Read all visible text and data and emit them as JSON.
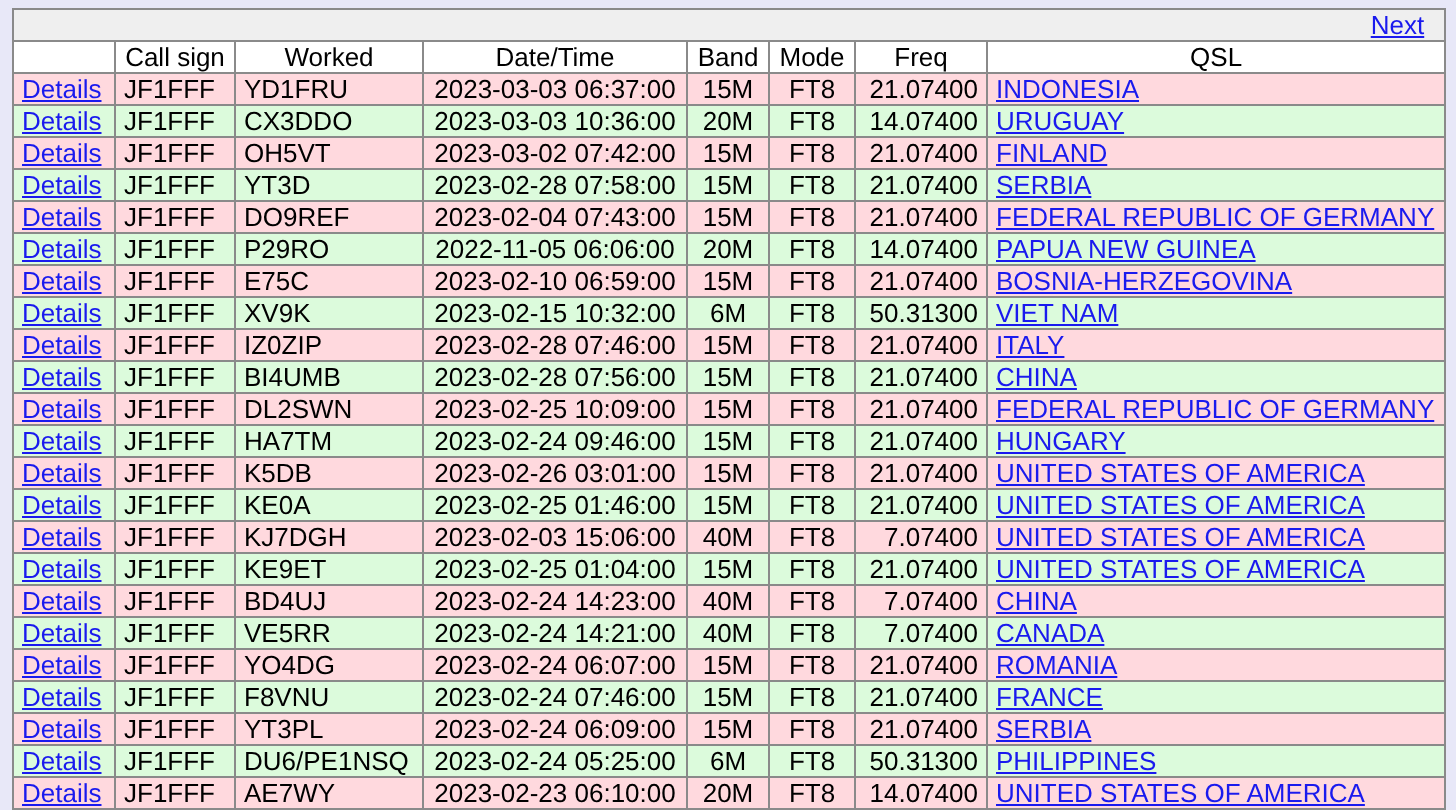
{
  "pager": {
    "next_link": "Next"
  },
  "table": {
    "columns": [
      "Call sign",
      "Worked",
      "Date/Time",
      "Band",
      "Mode",
      "Freq",
      "QSL"
    ],
    "rows": [
      {
        "details": "Details",
        "call_sign": "JF1FFF",
        "worked": "YD1FRU",
        "date_time": "2023-03-03 06:37:00",
        "band": "15M",
        "mode": "FT8",
        "freq": "21.07400",
        "qsl": "INDONESIA"
      },
      {
        "details": "Details",
        "call_sign": "JF1FFF",
        "worked": "CX3DDO",
        "date_time": "2023-03-03 10:36:00",
        "band": "20M",
        "mode": "FT8",
        "freq": "14.07400",
        "qsl": "URUGUAY"
      },
      {
        "details": "Details",
        "call_sign": "JF1FFF",
        "worked": "OH5VT",
        "date_time": "2023-03-02 07:42:00",
        "band": "15M",
        "mode": "FT8",
        "freq": "21.07400",
        "qsl": "FINLAND"
      },
      {
        "details": "Details",
        "call_sign": "JF1FFF",
        "worked": "YT3D",
        "date_time": "2023-02-28 07:58:00",
        "band": "15M",
        "mode": "FT8",
        "freq": "21.07400",
        "qsl": "SERBIA"
      },
      {
        "details": "Details",
        "call_sign": "JF1FFF",
        "worked": "DO9REF",
        "date_time": "2023-02-04 07:43:00",
        "band": "15M",
        "mode": "FT8",
        "freq": "21.07400",
        "qsl": "FEDERAL REPUBLIC OF GERMANY"
      },
      {
        "details": "Details",
        "call_sign": "JF1FFF",
        "worked": "P29RO",
        "date_time": "2022-11-05 06:06:00",
        "band": "20M",
        "mode": "FT8",
        "freq": "14.07400",
        "qsl": "PAPUA NEW GUINEA"
      },
      {
        "details": "Details",
        "call_sign": "JF1FFF",
        "worked": "E75C",
        "date_time": "2023-02-10 06:59:00",
        "band": "15M",
        "mode": "FT8",
        "freq": "21.07400",
        "qsl": "BOSNIA-HERZEGOVINA"
      },
      {
        "details": "Details",
        "call_sign": "JF1FFF",
        "worked": "XV9K",
        "date_time": "2023-02-15 10:32:00",
        "band": "6M",
        "mode": "FT8",
        "freq": "50.31300",
        "qsl": "VIET NAM"
      },
      {
        "details": "Details",
        "call_sign": "JF1FFF",
        "worked": "IZ0ZIP",
        "date_time": "2023-02-28 07:46:00",
        "band": "15M",
        "mode": "FT8",
        "freq": "21.07400",
        "qsl": "ITALY"
      },
      {
        "details": "Details",
        "call_sign": "JF1FFF",
        "worked": "BI4UMB",
        "date_time": "2023-02-28 07:56:00",
        "band": "15M",
        "mode": "FT8",
        "freq": "21.07400",
        "qsl": "CHINA"
      },
      {
        "details": "Details",
        "call_sign": "JF1FFF",
        "worked": "DL2SWN",
        "date_time": "2023-02-25 10:09:00",
        "band": "15M",
        "mode": "FT8",
        "freq": "21.07400",
        "qsl": "FEDERAL REPUBLIC OF GERMANY"
      },
      {
        "details": "Details",
        "call_sign": "JF1FFF",
        "worked": "HA7TM",
        "date_time": "2023-02-24 09:46:00",
        "band": "15M",
        "mode": "FT8",
        "freq": "21.07400",
        "qsl": "HUNGARY"
      },
      {
        "details": "Details",
        "call_sign": "JF1FFF",
        "worked": "K5DB",
        "date_time": "2023-02-26 03:01:00",
        "band": "15M",
        "mode": "FT8",
        "freq": "21.07400",
        "qsl": "UNITED STATES OF AMERICA"
      },
      {
        "details": "Details",
        "call_sign": "JF1FFF",
        "worked": "KE0A",
        "date_time": "2023-02-25 01:46:00",
        "band": "15M",
        "mode": "FT8",
        "freq": "21.07400",
        "qsl": "UNITED STATES OF AMERICA"
      },
      {
        "details": "Details",
        "call_sign": "JF1FFF",
        "worked": "KJ7DGH",
        "date_time": "2023-02-03 15:06:00",
        "band": "40M",
        "mode": "FT8",
        "freq": "7.07400",
        "qsl": "UNITED STATES OF AMERICA"
      },
      {
        "details": "Details",
        "call_sign": "JF1FFF",
        "worked": "KE9ET",
        "date_time": "2023-02-25 01:04:00",
        "band": "15M",
        "mode": "FT8",
        "freq": "21.07400",
        "qsl": "UNITED STATES OF AMERICA"
      },
      {
        "details": "Details",
        "call_sign": "JF1FFF",
        "worked": "BD4UJ",
        "date_time": "2023-02-24 14:23:00",
        "band": "40M",
        "mode": "FT8",
        "freq": "7.07400",
        "qsl": "CHINA"
      },
      {
        "details": "Details",
        "call_sign": "JF1FFF",
        "worked": "VE5RR",
        "date_time": "2023-02-24 14:21:00",
        "band": "40M",
        "mode": "FT8",
        "freq": "7.07400",
        "qsl": "CANADA"
      },
      {
        "details": "Details",
        "call_sign": "JF1FFF",
        "worked": "YO4DG",
        "date_time": "2023-02-24 06:07:00",
        "band": "15M",
        "mode": "FT8",
        "freq": "21.07400",
        "qsl": "ROMANIA"
      },
      {
        "details": "Details",
        "call_sign": "JF1FFF",
        "worked": "F8VNU",
        "date_time": "2023-02-24 07:46:00",
        "band": "15M",
        "mode": "FT8",
        "freq": "21.07400",
        "qsl": "FRANCE"
      },
      {
        "details": "Details",
        "call_sign": "JF1FFF",
        "worked": "YT3PL",
        "date_time": "2023-02-24 06:09:00",
        "band": "15M",
        "mode": "FT8",
        "freq": "21.07400",
        "qsl": "SERBIA"
      },
      {
        "details": "Details",
        "call_sign": "JF1FFF",
        "worked": "DU6/PE1NSQ",
        "date_time": "2023-02-24 05:25:00",
        "band": "6M",
        "mode": "FT8",
        "freq": "50.31300",
        "qsl": "PHILIPPINES"
      },
      {
        "details": "Details",
        "call_sign": "JF1FFF",
        "worked": "AE7WY",
        "date_time": "2023-02-23 06:10:00",
        "band": "20M",
        "mode": "FT8",
        "freq": "14.07400",
        "qsl": "UNITED STATES OF AMERICA"
      }
    ]
  }
}
